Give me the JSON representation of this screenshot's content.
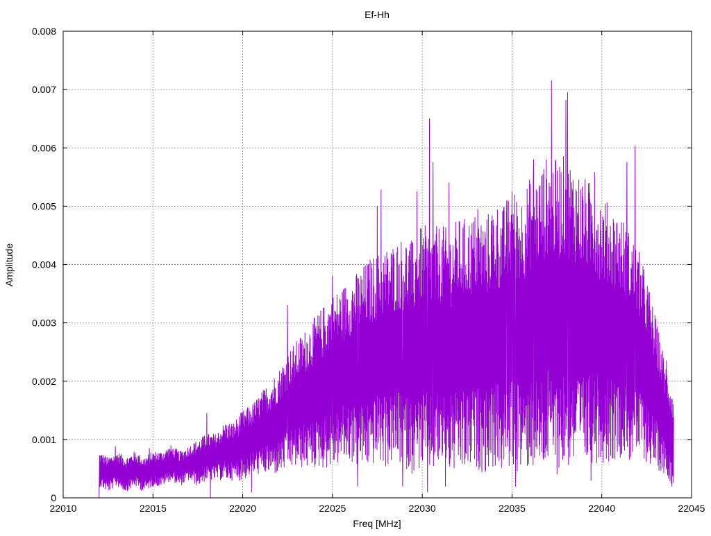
{
  "chart_data": {
    "type": "line",
    "title": "Ef-Hh",
    "xlabel": "Freq [MHz]",
    "ylabel": "Amplitude",
    "xlim": [
      22010,
      22045
    ],
    "ylim": [
      0,
      0.008
    ],
    "x_ticks": [
      22010,
      22015,
      22020,
      22025,
      22030,
      22035,
      22040,
      22045
    ],
    "x_tick_labels": [
      "22010",
      "22015",
      "22020",
      "22025",
      "22030",
      "22035",
      "22040",
      "22045"
    ],
    "y_ticks": [
      0,
      0.001,
      0.002,
      0.003,
      0.004,
      0.005,
      0.006,
      0.007,
      0.008
    ],
    "y_tick_labels": [
      "0",
      "0.001",
      "0.002",
      "0.003",
      "0.004",
      "0.005",
      "0.006",
      "0.007",
      "0.008"
    ],
    "grid": true,
    "legend": "none",
    "series": [
      {
        "color": "#9400d3",
        "x": [
          22012.0,
          22012.5,
          22013.0,
          22013.5,
          22014.0,
          22014.5,
          22015.0,
          22015.5,
          22016.0,
          22016.5,
          22017.0,
          22017.5,
          22018.0,
          22018.5,
          22019.0,
          22019.5,
          22020.0,
          22020.5,
          22021.0,
          22021.5,
          22022.0,
          22022.5,
          22023.0,
          22023.5,
          22024.0,
          22024.5,
          22025.0,
          22025.5,
          22026.0,
          22026.5,
          22027.0,
          22027.5,
          22028.0,
          22028.5,
          22029.0,
          22029.5,
          22030.0,
          22030.5,
          22031.0,
          22031.5,
          22032.0,
          22032.5,
          22033.0,
          22033.5,
          22034.0,
          22034.5,
          22035.0,
          22035.5,
          22036.0,
          22036.5,
          22037.0,
          22037.5,
          22038.0,
          22038.5,
          22039.0,
          22039.5,
          22040.0,
          22040.5,
          22041.0,
          22041.5,
          22042.0,
          22042.5,
          22043.0,
          22043.5,
          22044.0
        ],
        "y": [
          0.0005,
          0.0004,
          0.0005,
          0.0004,
          0.0005,
          0.0004,
          0.0005,
          0.0005,
          0.0006,
          0.0005,
          0.0006,
          0.0006,
          0.0007,
          0.0007,
          0.0008,
          0.0008,
          0.0009,
          0.001,
          0.0011,
          0.0012,
          0.0013,
          0.0015,
          0.0016,
          0.0017,
          0.0018,
          0.0019,
          0.002,
          0.0021,
          0.0022,
          0.0022,
          0.0023,
          0.0024,
          0.0024,
          0.0025,
          0.0025,
          0.0024,
          0.0026,
          0.0025,
          0.0026,
          0.0025,
          0.0026,
          0.0026,
          0.0027,
          0.0026,
          0.0028,
          0.0027,
          0.0029,
          0.0028,
          0.003,
          0.003,
          0.0032,
          0.0031,
          0.0032,
          0.0031,
          0.003,
          0.003,
          0.0029,
          0.0028,
          0.0028,
          0.0026,
          0.0025,
          0.0022,
          0.0018,
          0.0014,
          0.001
        ],
        "spread": [
          0.0003,
          0.0003,
          0.0003,
          0.0003,
          0.0003,
          0.0003,
          0.0003,
          0.0003,
          0.0003,
          0.0003,
          0.0003,
          0.0004,
          0.0004,
          0.0004,
          0.0005,
          0.0005,
          0.0006,
          0.0006,
          0.0007,
          0.0008,
          0.0009,
          0.001,
          0.0011,
          0.0012,
          0.0013,
          0.0014,
          0.0015,
          0.0015,
          0.0016,
          0.0017,
          0.0018,
          0.0018,
          0.0019,
          0.0019,
          0.002,
          0.002,
          0.0021,
          0.0021,
          0.0021,
          0.0021,
          0.0022,
          0.0022,
          0.0022,
          0.0022,
          0.0023,
          0.0023,
          0.0024,
          0.0024,
          0.0025,
          0.0026,
          0.0027,
          0.0027,
          0.0027,
          0.0026,
          0.0025,
          0.0024,
          0.0023,
          0.0022,
          0.0021,
          0.002,
          0.0018,
          0.0016,
          0.0013,
          0.001,
          0.0008
        ],
        "peaks": [
          {
            "x": 22012.05,
            "y": 0.00072
          },
          {
            "x": 22012.9,
            "y": 0.00088
          },
          {
            "x": 22014.8,
            "y": 0.00085
          },
          {
            "x": 22018.0,
            "y": 0.00145
          },
          {
            "x": 22022.5,
            "y": 0.0033
          },
          {
            "x": 22025.0,
            "y": 0.0038
          },
          {
            "x": 22027.5,
            "y": 0.005
          },
          {
            "x": 22027.7,
            "y": 0.00528
          },
          {
            "x": 22029.7,
            "y": 0.00525
          },
          {
            "x": 22030.4,
            "y": 0.0065
          },
          {
            "x": 22030.6,
            "y": 0.00575
          },
          {
            "x": 22031.5,
            "y": 0.0054
          },
          {
            "x": 22033.1,
            "y": 0.00495
          },
          {
            "x": 22034.7,
            "y": 0.0051
          },
          {
            "x": 22035.0,
            "y": 0.00525
          },
          {
            "x": 22036.2,
            "y": 0.0058
          },
          {
            "x": 22037.2,
            "y": 0.00715
          },
          {
            "x": 22038.0,
            "y": 0.00682
          },
          {
            "x": 22038.1,
            "y": 0.00695
          },
          {
            "x": 22039.6,
            "y": 0.00558
          },
          {
            "x": 22041.4,
            "y": 0.00575
          },
          {
            "x": 22041.85,
            "y": 0.00603
          },
          {
            "x": 22043.6,
            "y": 0.00235
          },
          {
            "x": 22044.0,
            "y": 0.00138
          }
        ],
        "dips": [
          {
            "x": 22012.0,
            "y": 0.0
          },
          {
            "x": 22018.2,
            "y": 0.0
          },
          {
            "x": 22020.5,
            "y": 0.0001
          },
          {
            "x": 22026.4,
            "y": 0.0002
          },
          {
            "x": 22028.9,
            "y": 0.0002
          },
          {
            "x": 22030.3,
            "y": 0.0001
          },
          {
            "x": 22031.3,
            "y": 0.0002
          },
          {
            "x": 22035.2,
            "y": 0.0002
          },
          {
            "x": 22039.4,
            "y": 0.0003
          },
          {
            "x": 22043.9,
            "y": 0.0002
          }
        ]
      }
    ]
  }
}
